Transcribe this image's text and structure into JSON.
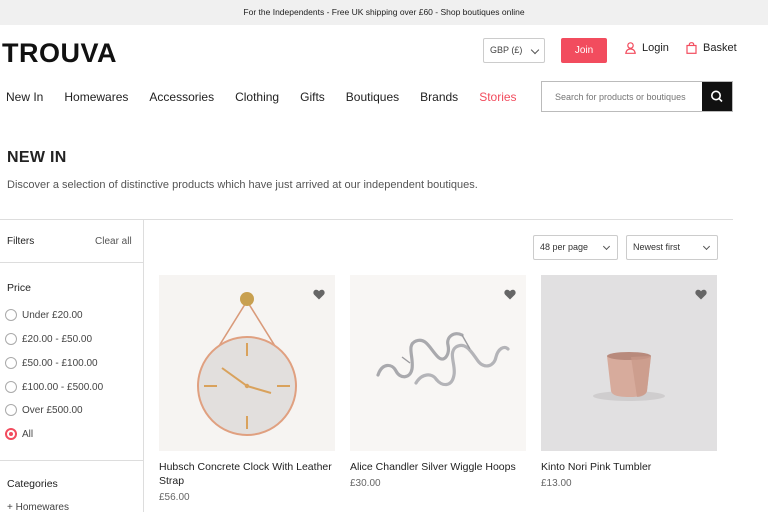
{
  "promo": {
    "text": "For the Independents - Free UK shipping over £60 - Shop boutiques online"
  },
  "header": {
    "logo": "TROUVA",
    "currency": "GBP (£)",
    "join": "Join",
    "login": "Login",
    "basket": "Basket",
    "accent_color": "#f24c5e"
  },
  "nav": {
    "items": [
      "New In",
      "Homewares",
      "Accessories",
      "Clothing",
      "Gifts",
      "Boutiques",
      "Brands",
      "Stories"
    ]
  },
  "search": {
    "placeholder": "Search for products or boutiques"
  },
  "page": {
    "title": "NEW IN",
    "description": "Discover a selection of distinctive products which have just arrived at our independent boutiques."
  },
  "filters": {
    "heading": "Filters",
    "clear_all": "Clear all",
    "price_heading": "Price",
    "price_options": [
      "Under £20.00",
      "£20.00 - £50.00",
      "£50.00 - £100.00",
      "£100.00 - £500.00",
      "Over £500.00",
      "All"
    ],
    "selected_price": "All",
    "categories_heading": "Categories",
    "categories": [
      "+ Homewares"
    ]
  },
  "toolbar": {
    "per_page": "48 per page",
    "sort": "Newest first"
  },
  "products": [
    {
      "name": "Hubsch Concrete Clock With Leather Strap",
      "price": "£56.00"
    },
    {
      "name": "Alice Chandler Silver Wiggle Hoops",
      "price": "£30.00"
    },
    {
      "name": "Kinto Nori Pink Tumbler",
      "price": "£13.00"
    }
  ]
}
